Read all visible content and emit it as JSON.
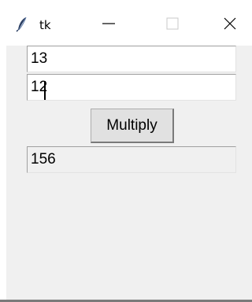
{
  "window": {
    "title": "tk",
    "app_icon": "feather-icon",
    "minimize_icon": "minimize-icon",
    "maximize_icon": "maximize-icon",
    "close_icon": "close-icon"
  },
  "form": {
    "entry_a_value": "13",
    "entry_b_value": "12",
    "multiply_label": "Multiply",
    "result_value": "156"
  },
  "colors": {
    "client_background": "#f0f0f0",
    "button_background": "#e1e1e1"
  }
}
